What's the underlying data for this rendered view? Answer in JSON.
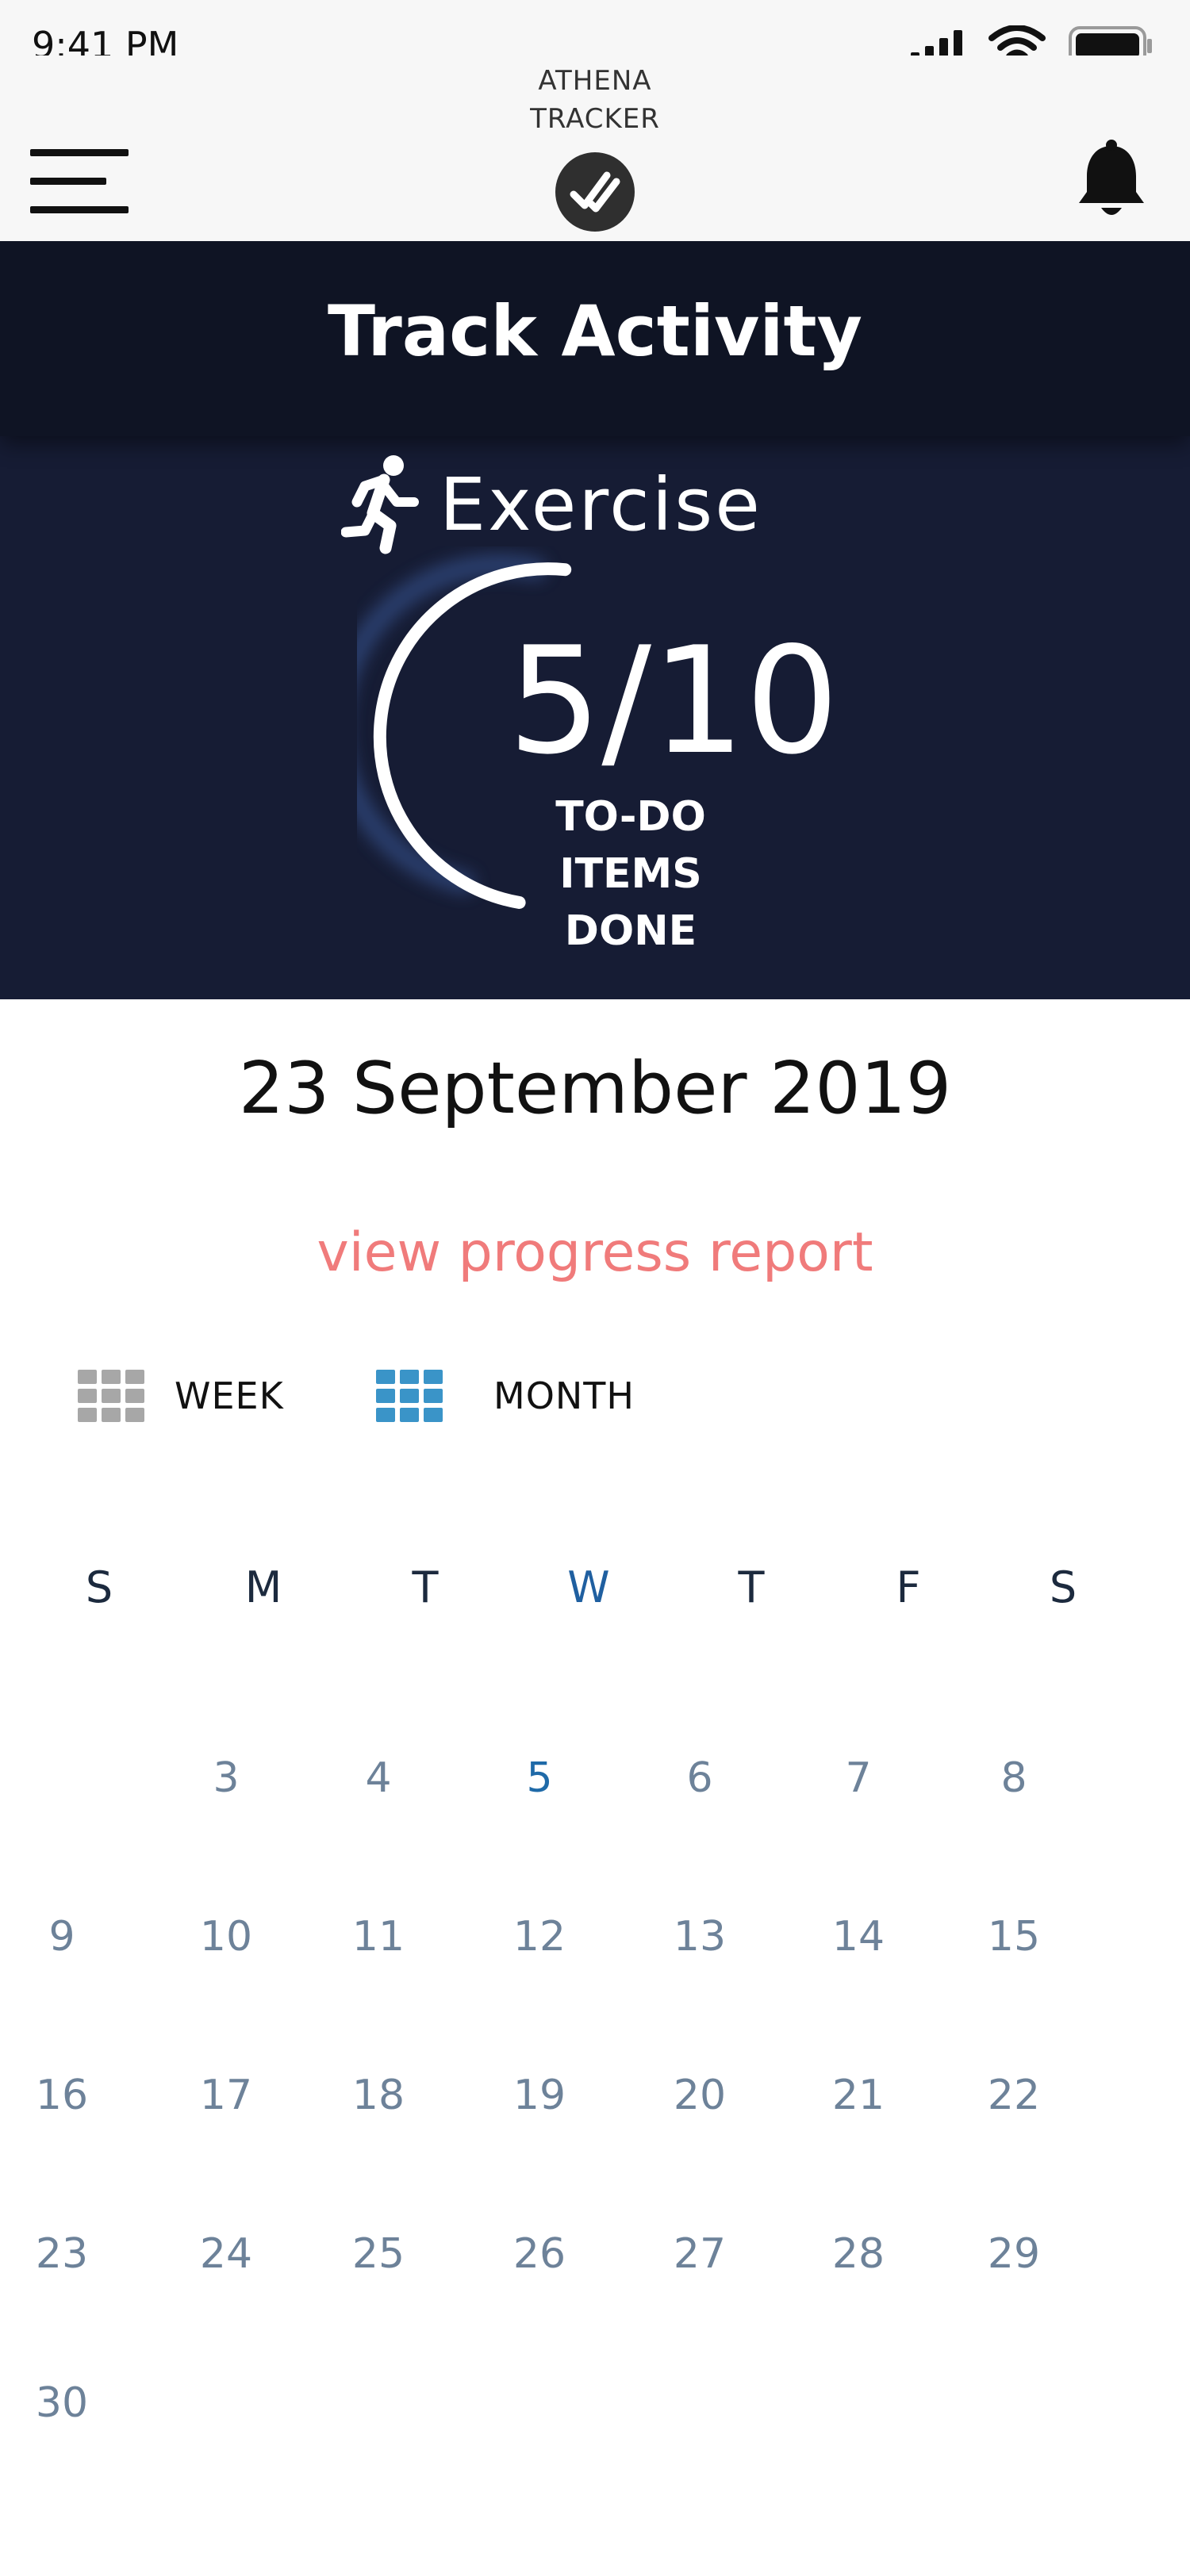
{
  "status_bar": {
    "time": "9:41 PM"
  },
  "app": {
    "title_line1": "ATHENA",
    "title_line2": "TRACKER"
  },
  "hero": {
    "title": "Track Activity",
    "category": "Exercise",
    "done": 5,
    "total": 10,
    "count_text": "5/10",
    "caption_line1": "TO-DO",
    "caption_line2": "ITEMS DONE"
  },
  "date_heading": "23 September 2019",
  "report_link": "view progress report",
  "view_toggle": {
    "week_label": "WEEK",
    "month_label": "MONTH",
    "selected": "MONTH"
  },
  "calendar": {
    "weekdays": [
      "S",
      "M",
      "T",
      "W",
      "T",
      "F",
      "S"
    ],
    "highlight_weekday_index": 3,
    "weeks": [
      [
        "",
        "3",
        "4",
        "5",
        "6",
        "7",
        "8"
      ],
      [
        "9",
        "10",
        "11",
        "12",
        "13",
        "14",
        "15"
      ],
      [
        "16",
        "17",
        "18",
        "19",
        "20",
        "21",
        "22"
      ],
      [
        "23",
        "24",
        "25",
        "26",
        "27",
        "28",
        "29"
      ],
      [
        "30",
        "",
        "",
        "",
        "",
        "",
        ""
      ]
    ],
    "highlight_day": "5"
  },
  "colors": {
    "hero_bg": "#161c34",
    "hero_header_bg": "#0f1424",
    "link": "#f07b7b",
    "accent_blue": "#3a94c8",
    "day_text": "#6d8299"
  },
  "icons": {
    "menu": "hamburger-icon",
    "logo": "double-check-icon",
    "bell": "bell-icon",
    "exercise": "running-person-icon",
    "week": "grid-gray-icon",
    "month": "grid-blue-icon"
  }
}
